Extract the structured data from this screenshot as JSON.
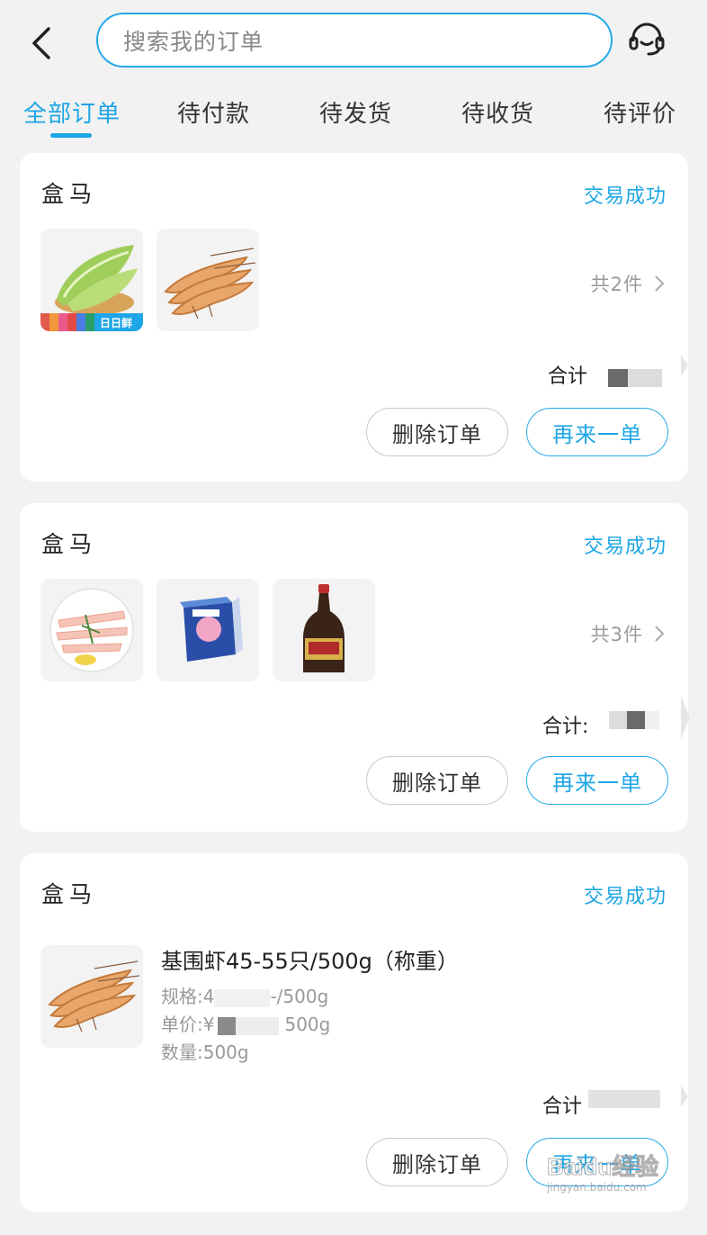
{
  "header": {
    "search_placeholder": "搜索我的订单",
    "back_icon": "chevron-left-icon",
    "service_icon": "headset-icon"
  },
  "tabs": [
    {
      "label": "全部订单",
      "active": true
    },
    {
      "label": "待付款",
      "active": false
    },
    {
      "label": "待发货",
      "active": false
    },
    {
      "label": "待收货",
      "active": false
    },
    {
      "label": "待评价",
      "active": false
    }
  ],
  "orders": [
    {
      "shop": "盒马",
      "status": "交易成功",
      "thumbnails": [
        "lettuce",
        "shrimp"
      ],
      "thumb_badge": "日日鲜",
      "count": "共2件",
      "total_label": "合计",
      "delete_label": "删除订单",
      "again_label": "再来一单"
    },
    {
      "shop": "盒马",
      "status": "交易成功",
      "thumbnails": [
        "fish-fillet",
        "tissue-box",
        "soy-sauce"
      ],
      "count": "共3件",
      "total_label": "合计:",
      "delete_label": "删除订单",
      "again_label": "再来一单"
    },
    {
      "shop": "盒马",
      "status": "交易成功",
      "thumbnails": [
        "shrimp"
      ],
      "item_title": "基围虾45-55只/500g（称重）",
      "spec": "规格:4",
      "spec_tail": "-/500g",
      "unit_price": "单价:¥",
      "unit_price_tail": "500g",
      "quantity": "数量:500g",
      "total_label": "合计",
      "delete_label": "删除订单",
      "again_label": "再来一单"
    }
  ],
  "watermark": {
    "text": "Baidu经验",
    "sub": "jingyan.baidu.com"
  },
  "colors": {
    "accent": "#1ea6e6",
    "background": "#f2f2f2",
    "card": "#ffffff"
  }
}
